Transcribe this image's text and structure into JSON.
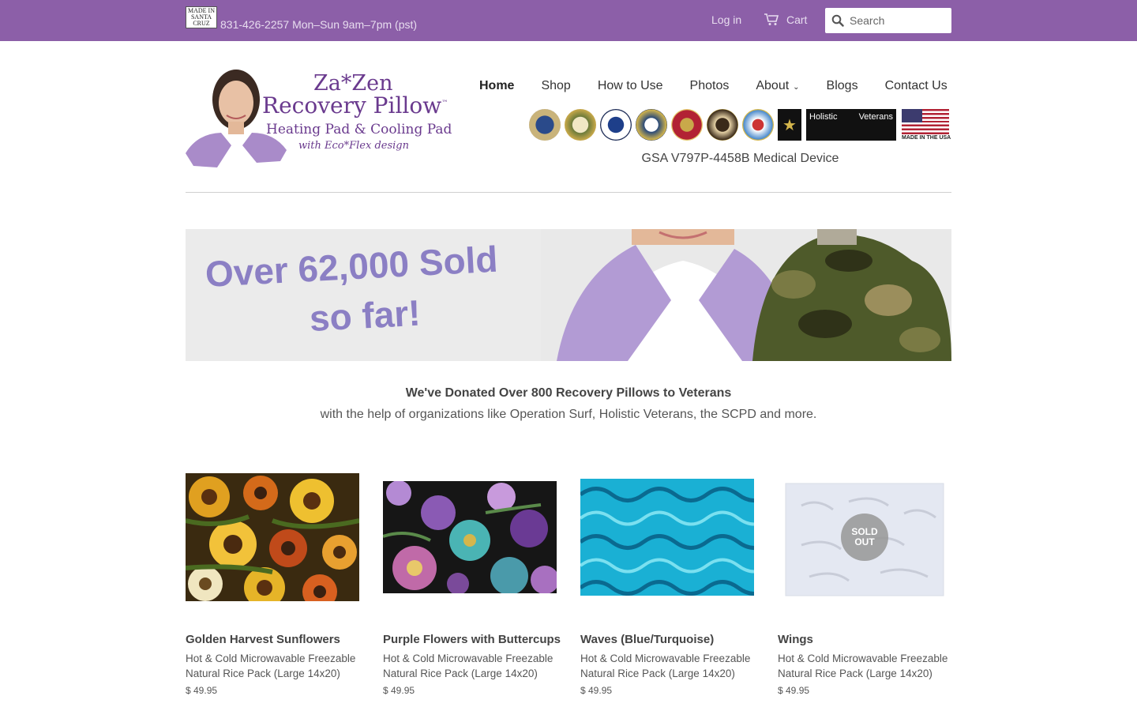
{
  "topbar": {
    "logo_lines": [
      "MADE IN",
      "SANTA",
      "CRUZ"
    ],
    "phone": "831-426-2257 Mon–Sun 9am–7pm (pst)",
    "login": "Log in",
    "cart": "Cart",
    "search_placeholder": "Search"
  },
  "brand": {
    "line1": "Za*Zen",
    "line2": "Recovery Pillow",
    "tm": "™",
    "line3": "Heating Pad & Cooling Pad",
    "line4": "with Eco*Flex design"
  },
  "nav": [
    {
      "label": "Home",
      "active": true
    },
    {
      "label": "Shop"
    },
    {
      "label": "How to Use"
    },
    {
      "label": "Photos"
    },
    {
      "label": "About"
    },
    {
      "label": "Blogs"
    },
    {
      "label": "Contact Us"
    }
  ],
  "badges": {
    "holistic_left": "Holistic",
    "holistic_right": "Veterans",
    "flag_text": "MADE IN THE USA"
  },
  "gsa": "GSA V797P-4458B Medical Device",
  "banner": {
    "line1": "Over 62,000 Sold",
    "line2": "so far!"
  },
  "donate": {
    "title": "We've Donated Over 800 Recovery Pillows to Veterans",
    "subtitle": "with the help of organizations like Operation Surf, Holistic Veterans, the SCPD and more."
  },
  "products": [
    {
      "title": "Golden Harvest Sunflowers",
      "desc": "Hot & Cold Microwavable Freezable Natural Rice Pack (Large 14x20)",
      "price": "$ 49.95"
    },
    {
      "title": "Purple Flowers with Buttercups",
      "desc": "Hot & Cold Microwavable Freezable Natural Rice Pack (Large 14x20)",
      "price": "$ 49.95"
    },
    {
      "title": "Waves (Blue/Turquoise)",
      "desc": "Hot & Cold Microwavable Freezable Natural Rice Pack (Large 14x20)",
      "price": "$ 49.95"
    },
    {
      "title": "Wings",
      "desc": "Hot & Cold Microwavable Freezable Natural Rice Pack (Large 14x20)",
      "price": "$ 49.95",
      "sold_out": "SOLD OUT"
    }
  ],
  "colors": {
    "topbar": "#8c5fa8",
    "brand": "#6a3a8e",
    "banner_text": "#8b7fc4"
  }
}
